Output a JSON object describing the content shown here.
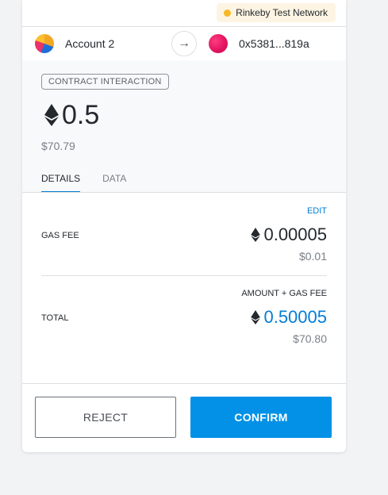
{
  "network": {
    "label": "Rinkeby Test Network",
    "dot_color": "#f6b824"
  },
  "accounts": {
    "from_name": "Account 2",
    "to_address": "0x5381...819a",
    "arrow": "→"
  },
  "summary": {
    "badge": "CONTRACT INTERACTION",
    "amount": "0.5",
    "fiat": "$70.79",
    "tabs": [
      "DETAILS",
      "DATA"
    ],
    "active_tab": "DETAILS"
  },
  "details": {
    "gas_fee_label": "GAS FEE",
    "edit_label": "EDIT",
    "gas_fee_amount": "0.00005",
    "gas_fee_fiat": "$0.01",
    "total_sublabel": "AMOUNT + GAS FEE",
    "total_label": "TOTAL",
    "total_amount": "0.50005",
    "total_fiat": "$70.80"
  },
  "buttons": {
    "reject": "REJECT",
    "confirm": "CONFIRM"
  },
  "colors": {
    "accent": "#037dd6",
    "confirm_bg": "#0291e6"
  },
  "icons": {
    "network_dot": "status-dot",
    "arrow": "arrow-right-icon",
    "currency": "ethereum-icon"
  }
}
